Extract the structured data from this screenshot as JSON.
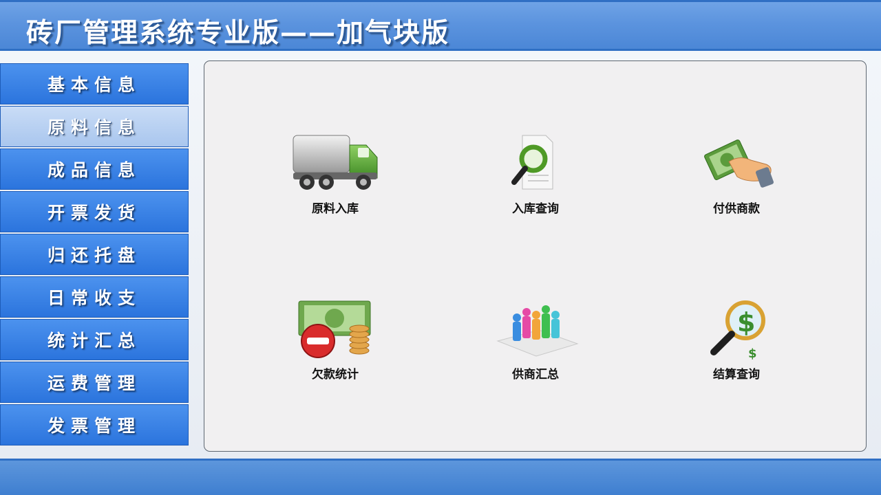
{
  "app": {
    "title": "砖厂管理系统专业版——加气块版"
  },
  "sidebar": {
    "items": [
      {
        "label": "基本信息"
      },
      {
        "label": "原料信息"
      },
      {
        "label": "成品信息"
      },
      {
        "label": "开票发货"
      },
      {
        "label": "归还托盘"
      },
      {
        "label": "日常收支"
      },
      {
        "label": "统计汇总"
      },
      {
        "label": "运费管理"
      },
      {
        "label": "发票管理"
      }
    ],
    "active_index": 1
  },
  "main": {
    "tiles": [
      {
        "label": "原料入库",
        "icon": "truck-icon"
      },
      {
        "label": "入库查询",
        "icon": "document-search-icon"
      },
      {
        "label": "付供商款",
        "icon": "money-hand-icon"
      },
      {
        "label": "欠款统计",
        "icon": "money-minus-icon"
      },
      {
        "label": "供商汇总",
        "icon": "people-chart-icon"
      },
      {
        "label": "结算查询",
        "icon": "dollar-search-icon"
      }
    ]
  },
  "colors": {
    "header_blue": "#5b93de",
    "nav_blue": "#2b74dd",
    "nav_active": "#a9c6ee",
    "panel_bg": "#f1f0f1"
  }
}
